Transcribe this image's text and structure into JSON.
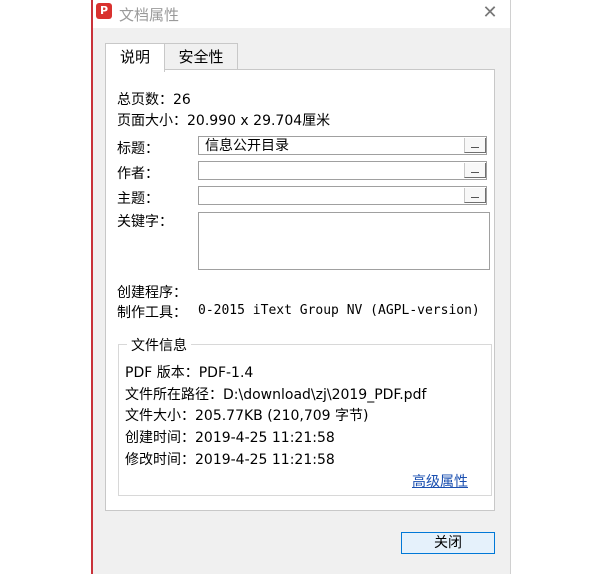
{
  "window": {
    "title": "文档属性"
  },
  "tabs": [
    {
      "label": "说明",
      "active": true
    },
    {
      "label": "安全性",
      "active": false
    }
  ],
  "info": {
    "page_count": "总页数：26",
    "page_size": "页面大小：20.990 x 29.704厘米"
  },
  "fields": {
    "title_label": "标题：",
    "title_value": "信息公开目录",
    "author_label": "作者：",
    "author_value": "",
    "subject_label": "主题：",
    "subject_value": "",
    "keywords_label": "关键字：",
    "keywords_value": ""
  },
  "creator": {
    "creator_label": "创建程序：",
    "producer_label": "制作工具：",
    "producer_value": "0-2015 iText Group NV (AGPL-version)"
  },
  "file_info": {
    "group_title": "文件信息",
    "pdf_version": "PDF 版本：PDF-1.4",
    "path": "文件所在路径：D:\\download\\zj\\2019_PDF.pdf",
    "size": "文件大小：205.77KB (210,709 字节)",
    "created": "创建时间：2019-4-25 11:21:58",
    "modified": "修改时间：2019-4-25 11:21:58"
  },
  "advanced_link": "高级属性",
  "close_button": "关闭",
  "colors": {
    "accent": "#0078d7",
    "app_icon": "#d9322f",
    "link": "#1a4fb0"
  }
}
